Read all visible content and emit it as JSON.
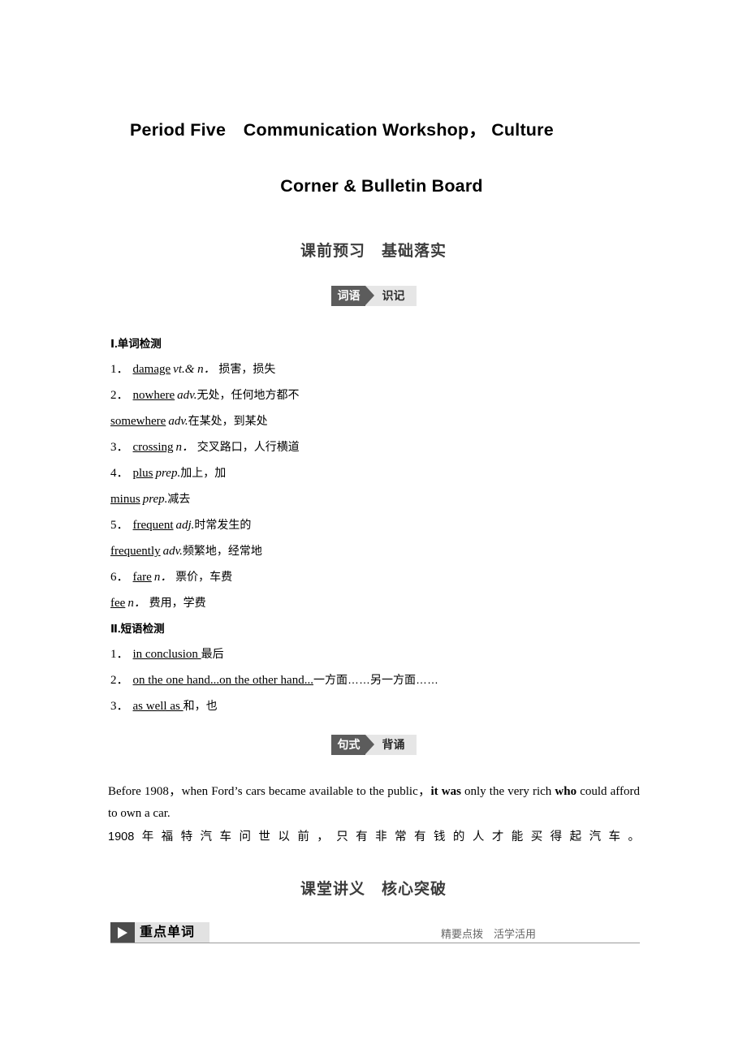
{
  "title": {
    "line1": "Period Five Communication Workshop， Culture",
    "line2": "Corner & Bulletin Board"
  },
  "headings": {
    "preview": "课前预习　基础落实",
    "lecture": "课堂讲义　核心突破"
  },
  "badges": {
    "vocab": {
      "tag": "词语",
      "label": "识记"
    },
    "sentence": {
      "tag": "句式",
      "label": "背诵"
    }
  },
  "part1": {
    "heading": "Ⅰ.单词检测",
    "items": [
      {
        "num": "1．",
        "word": "damage",
        "pos": "vt.& n．",
        "cn": "损害，损失"
      },
      {
        "num": "2．",
        "word": "nowhere",
        "pos": "adv.",
        "cn": "无处，任何地方都不"
      },
      {
        "num": "",
        "word": "somewhere",
        "pos": "adv.",
        "cn": "在某处，到某处"
      },
      {
        "num": "3．",
        "word": "crossing",
        "pos": "n．",
        "cn": "交叉路口，人行横道"
      },
      {
        "num": "4．",
        "word": "plus",
        "pos": "prep.",
        "cn": "加上，加"
      },
      {
        "num": "",
        "word": "minus",
        "pos": "prep.",
        "cn": "减去"
      },
      {
        "num": "5．",
        "word": "frequent",
        "pos": "adj.",
        "cn": "时常发生的"
      },
      {
        "num": "",
        "word": "frequently",
        "pos": "adv.",
        "cn": "频繁地，经常地"
      },
      {
        "num": "6．",
        "word": "fare",
        "pos": "n．",
        "cn": "票价，车费"
      },
      {
        "num": "",
        "word": "fee",
        "pos": "n．",
        "cn": "费用，学费"
      }
    ]
  },
  "part2": {
    "heading": "Ⅱ.短语检测",
    "items": [
      {
        "num": "1．",
        "word": "in conclusion ",
        "cn": "最后"
      },
      {
        "num": "2．",
        "word": "on the one hand...on the other hand...",
        "cn": "一方面……另一方面……"
      },
      {
        "num": "3．",
        "word": "as well as ",
        "cn": "和，也"
      }
    ]
  },
  "sentence": {
    "en_part1": "Before 1908，when Ford’s cars became available to the public，",
    "en_bold1": "it was",
    "en_part2": " only the very rich ",
    "en_bold2": "who",
    "en_part3": " could afford to own a car.",
    "cn": "1908年福特汽车问世以前，只有非常有钱的人才能买得起汽车。"
  },
  "banner": {
    "title": "重点单词",
    "subtitle": "精要点拨　活学活用",
    "play_icon": "play-triangle-icon"
  },
  "colors": {
    "tag_dark": "#5c5c5c",
    "tag_light": "#e6e6e6",
    "banner_dark": "#4c4c4c",
    "banner_light": "#e2e2e2",
    "heading_gray": "#3c3c3c"
  }
}
